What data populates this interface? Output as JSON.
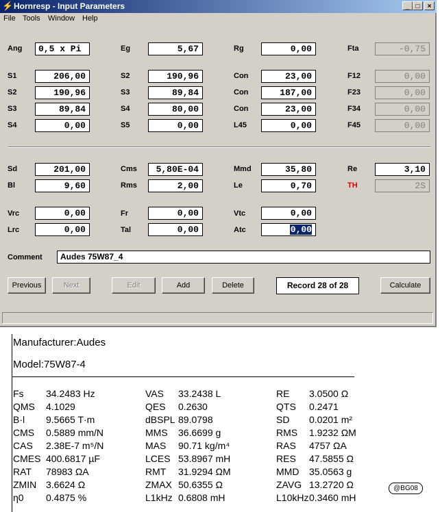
{
  "window": {
    "title": "Hornresp - Input Parameters",
    "controls": {
      "minimize": "_",
      "maximize": "□",
      "close": "×"
    }
  },
  "menu": [
    "File",
    "Tools",
    "Window",
    "Help"
  ],
  "params": {
    "ang": {
      "label": "Ang",
      "value": "0,5 x Pi"
    },
    "eg": {
      "label": "Eg",
      "value": "5,67"
    },
    "rg": {
      "label": "Rg",
      "value": "0,00"
    },
    "fta": {
      "label": "Fta",
      "value": "-0,75"
    },
    "s1a": {
      "label": "S1",
      "value": "206,00"
    },
    "s2b": {
      "label": "S2",
      "value": "190,96"
    },
    "con1": {
      "label": "Con",
      "value": "23,00"
    },
    "f12": {
      "label": "F12",
      "value": "0,00"
    },
    "s2a": {
      "label": "S2",
      "value": "190,96"
    },
    "s3b": {
      "label": "S3",
      "value": "89,84"
    },
    "con2": {
      "label": "Con",
      "value": "187,00"
    },
    "f23": {
      "label": "F23",
      "value": "0,00"
    },
    "s3a": {
      "label": "S3",
      "value": "89,84"
    },
    "s4b": {
      "label": "S4",
      "value": "80,00"
    },
    "con3": {
      "label": "Con",
      "value": "23,00"
    },
    "f34": {
      "label": "F34",
      "value": "0,00"
    },
    "s4a": {
      "label": "S4",
      "value": "0,00"
    },
    "s5": {
      "label": "S5",
      "value": "0,00"
    },
    "l45": {
      "label": "L45",
      "value": "0,00"
    },
    "f45": {
      "label": "F45",
      "value": "0,00"
    },
    "sd": {
      "label": "Sd",
      "value": "201,00"
    },
    "cms": {
      "label": "Cms",
      "value": "5,80E-04"
    },
    "mmd": {
      "label": "Mmd",
      "value": "35,80"
    },
    "re": {
      "label": "Re",
      "value": "3,10"
    },
    "bl": {
      "label": "Bl",
      "value": "9,60"
    },
    "rms": {
      "label": "Rms",
      "value": "2,00"
    },
    "le": {
      "label": "Le",
      "value": "0,70"
    },
    "th": {
      "label": "TH",
      "value": "2S"
    },
    "vrc": {
      "label": "Vrc",
      "value": "0,00"
    },
    "fr": {
      "label": "Fr",
      "value": "0,00"
    },
    "vtc": {
      "label": "Vtc",
      "value": "0,00"
    },
    "lrc": {
      "label": "Lrc",
      "value": "0,00"
    },
    "tal": {
      "label": "Tal",
      "value": "0,00"
    },
    "atc": {
      "label": "Atc",
      "value": "0,00"
    }
  },
  "comment": {
    "label": "Comment",
    "value": "Audes 75W87_4"
  },
  "buttons": {
    "previous": "Previous",
    "next": "Next",
    "edit": "Edit",
    "add": "Add",
    "delete": "Delete",
    "record": "Record 28 of 28",
    "calculate": "Calculate"
  },
  "colors": {
    "th_label": "#e00000",
    "title_start": "#0a246a",
    "title_end": "#a6caf0",
    "face": "#d4d0c8"
  },
  "spec": {
    "manufacturer": "Manufacturer:Audes",
    "model": "Model:75W87-4",
    "rows": [
      [
        [
          "Fs",
          "34.2483 Hz"
        ],
        [
          "VAS",
          "33.2438 L"
        ],
        [
          "RE",
          "3.0500 Ω"
        ]
      ],
      [
        [
          "QMS",
          "4.1029"
        ],
        [
          "QES",
          "0.2630"
        ],
        [
          "QTS",
          "0.2471"
        ]
      ],
      [
        [
          "B·l",
          "9.5665 T·m"
        ],
        [
          "dBSPL",
          "89.0798"
        ],
        [
          "SD",
          "0.0201 m²"
        ]
      ],
      [
        [
          "CMS",
          "0.5889 mm/N"
        ],
        [
          "MMS",
          "36.6699 g"
        ],
        [
          "RMS",
          "1.9232 ΩM"
        ]
      ],
      [
        [
          "CAS",
          "2.38E-7 m⁵/N"
        ],
        [
          "MAS",
          "90.71 kg/m⁴"
        ],
        [
          "RAS",
          "4757 ΩA"
        ]
      ],
      [
        [
          "CMES",
          "400.6817 µF"
        ],
        [
          "LCES",
          "53.8967 mH"
        ],
        [
          "RES",
          "47.5855 Ω"
        ]
      ],
      [
        [
          "RAT",
          "78983 ΩA"
        ],
        [
          "RMT",
          "31.9294 ΩM"
        ],
        [
          "MMD",
          "35.0563 g"
        ]
      ],
      [
        [
          "ZMIN",
          "3.6624 Ω"
        ],
        [
          "ZMAX",
          "50.6355 Ω"
        ],
        [
          "ZAVG",
          "13.2720 Ω"
        ]
      ],
      [
        [
          "η0",
          "0.4875 %"
        ],
        [
          "L1kHz",
          "0.6808 mH"
        ],
        [
          "L10kHz",
          "0.3460 mH"
        ]
      ]
    ],
    "stamp": "@BG08"
  }
}
